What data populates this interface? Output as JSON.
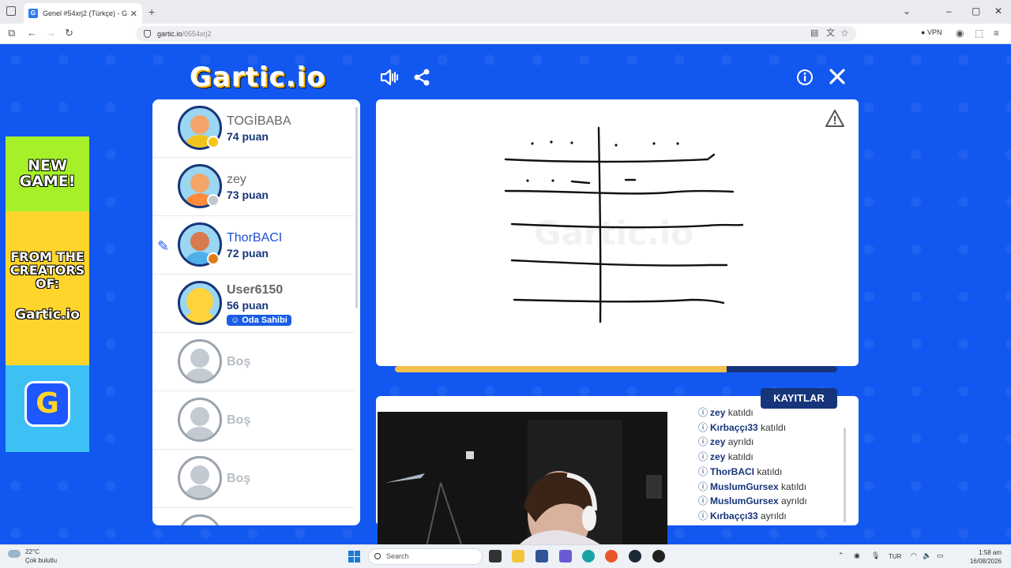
{
  "browser": {
    "tab_title": "Genel #54xrj2 (Türkçe) - Gartic.i",
    "url_host": "gartic.io",
    "url_path": "/0554xrj2",
    "vpn_label": "VPN"
  },
  "game": {
    "logo_text": "Gartic.io",
    "watermark": "Gartic.io",
    "timer_progress": 0.75,
    "colors": {
      "background": "#1257f0",
      "navy": "#16357a",
      "accent_blue": "#1a5ce6",
      "timer_yellow": "#f3c04f"
    }
  },
  "ad": {
    "line1": "NEW GAME!",
    "line2": "FROM THE CREATORS OF:",
    "logo": "Gartic.io",
    "badge": "G"
  },
  "players": [
    {
      "name": "TOGİBABA",
      "points": "74 puan",
      "status_color": "#f5c518"
    },
    {
      "name": "zey",
      "points": "73 puan",
      "status_color": "#c4c8cc"
    },
    {
      "name": "ThorBACI",
      "points": "72 puan",
      "status_color": "#e07b1a",
      "drawing": true
    },
    {
      "name": "User6150",
      "points": "56 puan",
      "badge": "Oda Sahibi"
    },
    {
      "name": "Boş"
    },
    {
      "name": "Boş"
    },
    {
      "name": "Boş"
    }
  ],
  "logs": {
    "tab_label": "KAYITLAR",
    "entries": [
      {
        "user": "zey",
        "action": "katıldı"
      },
      {
        "user": "Kırbaççı33",
        "action": "katıldı"
      },
      {
        "user": "zey",
        "action": "ayrıldı"
      },
      {
        "user": "zey",
        "action": "katıldı"
      },
      {
        "user": "ThorBACI",
        "action": "katıldı"
      },
      {
        "user": "MuslumGursex",
        "action": "katıldı"
      },
      {
        "user": "MuslumGursex",
        "action": "ayrıldı"
      },
      {
        "user": "Kırbaççı33",
        "action": "ayrıldı"
      }
    ]
  },
  "taskbar": {
    "weather_temp": "22°C",
    "weather_desc": "Çok bulutlu",
    "search_placeholder": "Search",
    "lang": "TUR",
    "time": "1:58 am",
    "date": "16/08/2026"
  }
}
